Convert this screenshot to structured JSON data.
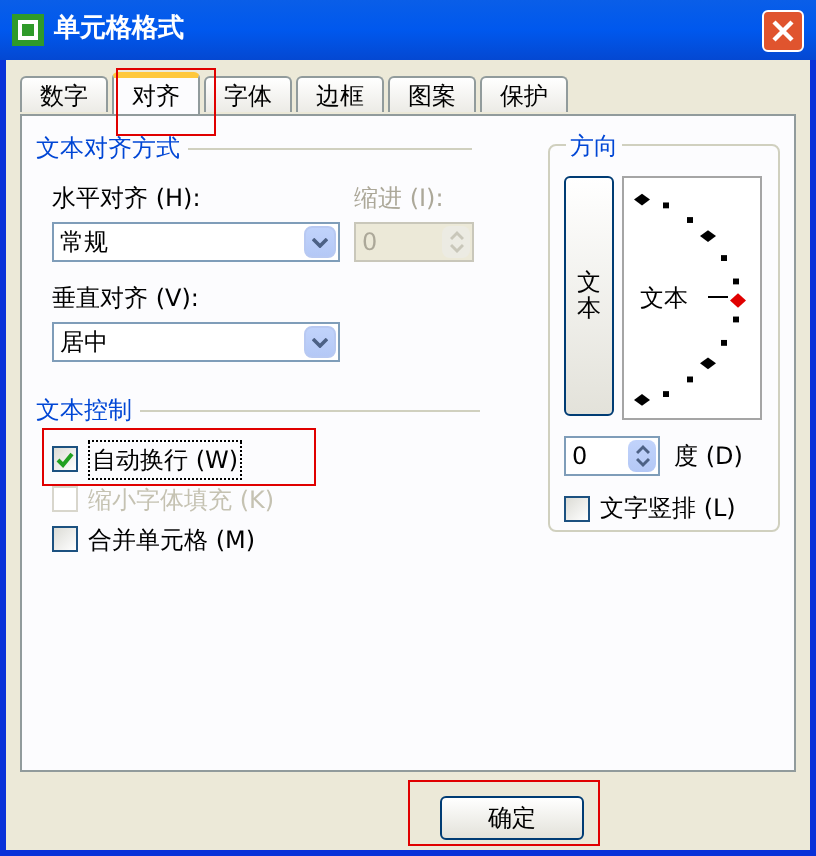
{
  "window": {
    "title": "单元格格式"
  },
  "tabs": [
    {
      "label": "数字",
      "selected": false
    },
    {
      "label": "对齐",
      "selected": true
    },
    {
      "label": "字体",
      "selected": false
    },
    {
      "label": "边框",
      "selected": false
    },
    {
      "label": "图案",
      "selected": false
    },
    {
      "label": "保护",
      "selected": false
    }
  ],
  "alignment": {
    "title": "文本对齐方式",
    "horizontal": {
      "label": "水平对齐 (H):",
      "value": "常规"
    },
    "indent": {
      "label": "缩进 (I):",
      "value": "0",
      "disabled": true
    },
    "vertical": {
      "label": "垂直对齐 (V):",
      "value": "居中"
    }
  },
  "text_control": {
    "title": "文本控制",
    "options": [
      {
        "label": "自动换行 (W)",
        "checked": true,
        "disabled": false,
        "highlighted": true
      },
      {
        "label": "缩小字体填充 (K)",
        "checked": false,
        "disabled": true,
        "highlighted": false
      },
      {
        "label": "合并单元格 (M)",
        "checked": false,
        "disabled": false,
        "highlighted": false
      }
    ]
  },
  "orientation": {
    "title": "方向",
    "vertical_text_button": "文本",
    "dial_text": "文本",
    "degrees": {
      "value": "0",
      "label": "度 (D)"
    },
    "stack_checkbox": {
      "label": "文字竖排 (L)",
      "checked": false
    }
  },
  "buttons": [
    {
      "label": "确定",
      "highlighted": true
    }
  ]
}
